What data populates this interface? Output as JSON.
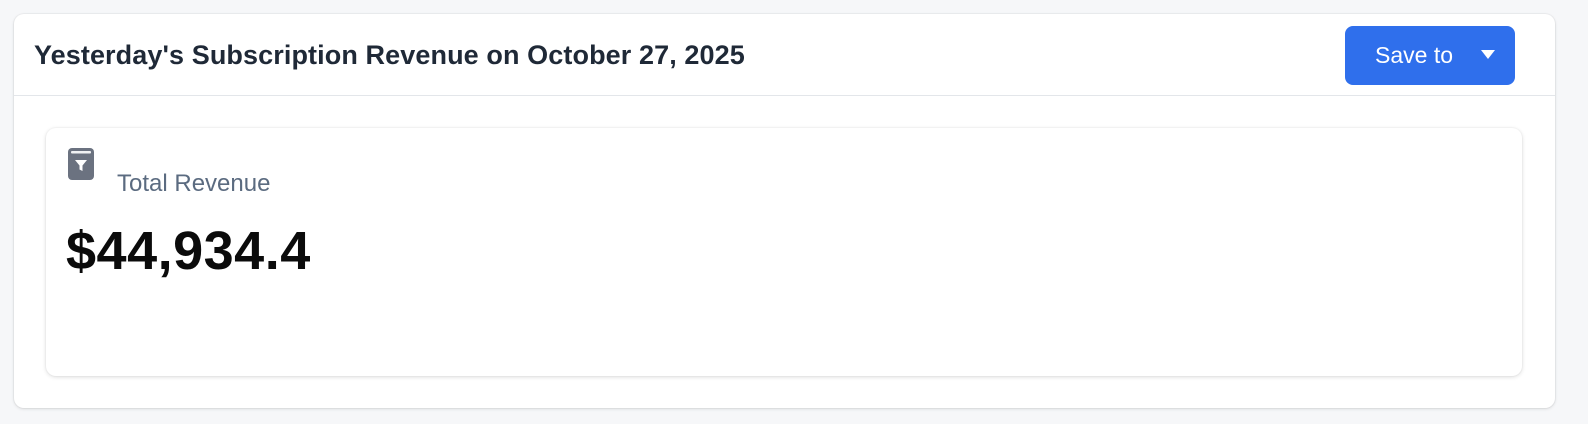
{
  "header": {
    "title": "Yesterday's Subscription Revenue on October 27, 2025",
    "save_button_label": "Save to"
  },
  "metric": {
    "icon": "receipt-filter-icon",
    "label": "Total Revenue",
    "value": "$44,934.4"
  },
  "colors": {
    "accent": "#2f6fec",
    "title_text": "#1f2937",
    "label_text": "#5b6b80",
    "icon": "#6b7280"
  }
}
